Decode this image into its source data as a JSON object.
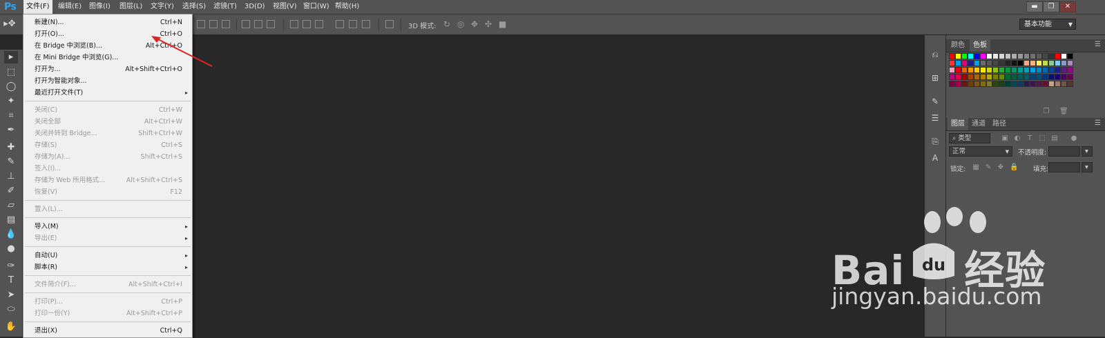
{
  "app": {
    "logo_text": "Ps"
  },
  "menubar": {
    "items": [
      "文件(F)",
      "编辑(E)",
      "图像(I)",
      "图层(L)",
      "文字(Y)",
      "选择(S)",
      "滤镜(T)",
      "3D(D)",
      "视图(V)",
      "窗口(W)",
      "帮助(H)"
    ],
    "active_index": 0
  },
  "window_controls": {
    "minimize": "▬",
    "restore": "❐",
    "close": "✕"
  },
  "optionsbar": {
    "label_3d": "3D 模式:",
    "workspace": "基本功能"
  },
  "file_menu": {
    "groups": [
      [
        {
          "label": "新建(N)...",
          "shortcut": "Ctrl+N",
          "enabled": true
        },
        {
          "label": "打开(O)...",
          "shortcut": "Ctrl+O",
          "enabled": true
        },
        {
          "label": "在 Bridge 中浏览(B)...",
          "shortcut": "Alt+Ctrl+O",
          "enabled": true
        },
        {
          "label": "在 Mini Bridge 中浏览(G)...",
          "shortcut": "",
          "enabled": true
        },
        {
          "label": "打开为...",
          "shortcut": "Alt+Shift+Ctrl+O",
          "enabled": true
        },
        {
          "label": "打开为智能对象...",
          "shortcut": "",
          "enabled": true
        },
        {
          "label": "最近打开文件(T)",
          "shortcut": "",
          "enabled": true,
          "submenu": true
        }
      ],
      [
        {
          "label": "关闭(C)",
          "shortcut": "Ctrl+W",
          "enabled": false
        },
        {
          "label": "关闭全部",
          "shortcut": "Alt+Ctrl+W",
          "enabled": false
        },
        {
          "label": "关闭并转到 Bridge...",
          "shortcut": "Shift+Ctrl+W",
          "enabled": false
        },
        {
          "label": "存储(S)",
          "shortcut": "Ctrl+S",
          "enabled": false
        },
        {
          "label": "存储为(A)...",
          "shortcut": "Shift+Ctrl+S",
          "enabled": false
        },
        {
          "label": "签入(I)...",
          "shortcut": "",
          "enabled": false
        },
        {
          "label": "存储为 Web 所用格式...",
          "shortcut": "Alt+Shift+Ctrl+S",
          "enabled": false
        },
        {
          "label": "恢复(V)",
          "shortcut": "F12",
          "enabled": false
        }
      ],
      [
        {
          "label": "置入(L)...",
          "shortcut": "",
          "enabled": false
        }
      ],
      [
        {
          "label": "导入(M)",
          "shortcut": "",
          "enabled": true,
          "submenu": true
        },
        {
          "label": "导出(E)",
          "shortcut": "",
          "enabled": false,
          "submenu": true
        }
      ],
      [
        {
          "label": "自动(U)",
          "shortcut": "",
          "enabled": true,
          "submenu": true
        },
        {
          "label": "脚本(R)",
          "shortcut": "",
          "enabled": true,
          "submenu": true
        }
      ],
      [
        {
          "label": "文件简介(F)...",
          "shortcut": "Alt+Shift+Ctrl+I",
          "enabled": false
        }
      ],
      [
        {
          "label": "打印(P)...",
          "shortcut": "Ctrl+P",
          "enabled": false
        },
        {
          "label": "打印一份(Y)",
          "shortcut": "Alt+Shift+Ctrl+P",
          "enabled": false
        }
      ],
      [
        {
          "label": "退出(X)",
          "shortcut": "Ctrl+Q",
          "enabled": true
        }
      ]
    ]
  },
  "color_panel": {
    "tabs": [
      "颜色",
      "色板"
    ],
    "active_tab": 1
  },
  "layers_panel": {
    "tabs": [
      "图层",
      "通道",
      "路径"
    ],
    "active_tab": 0,
    "filter_kind": "类型",
    "blend_mode": "正常",
    "opacity_label": "不透明度:",
    "lock_label": "锁定:",
    "fill_label": "填充:"
  },
  "colors": {
    "menubar_bg": "#535353",
    "canvas_bg": "#282828",
    "menu_bg": "#f0f0f0",
    "annotation_arrow": "#e02424"
  },
  "watermark": {
    "brand": "Bai",
    "brand_tail": "经验",
    "url": "jingyan.baidu.com"
  }
}
